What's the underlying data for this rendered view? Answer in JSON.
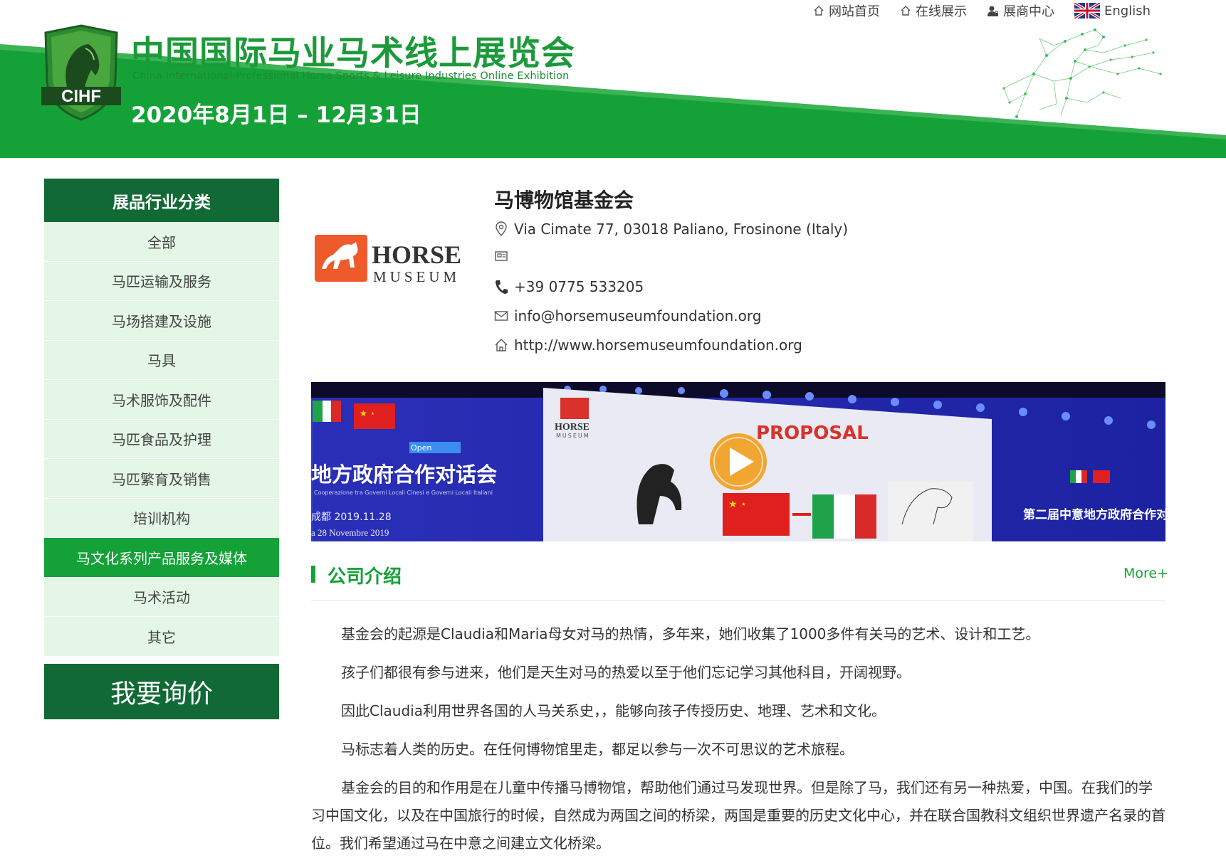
{
  "header": {
    "title": "中国国际马业马术线上展览会",
    "subtitle": "China International Professional Horse Sports & Leisure Industries Online Exhibition",
    "date": "2020年8月1日 – 12月31日",
    "logo_text": "CIHF",
    "colors": {
      "brand_green": "#14a238",
      "dark_green": "#116a35",
      "title_green": "#1c9a3a"
    }
  },
  "topnav": {
    "items": [
      {
        "label": "网站首页",
        "icon": "home-icon"
      },
      {
        "label": "在线展示",
        "icon": "home-icon"
      },
      {
        "label": "展商中心",
        "icon": "user-lock-icon"
      },
      {
        "label": "English",
        "icon": "uk-flag-icon"
      }
    ]
  },
  "sidebar": {
    "heading": "展品行业分类",
    "items": [
      {
        "label": "全部"
      },
      {
        "label": "马匹运输及服务"
      },
      {
        "label": "马场搭建及设施"
      },
      {
        "label": "马具"
      },
      {
        "label": "马术服饰及配件"
      },
      {
        "label": "马匹食品及护理"
      },
      {
        "label": "马匹繁育及销售"
      },
      {
        "label": "培训机构"
      },
      {
        "label": "马文化系列产品服务及媒体",
        "active": true
      },
      {
        "label": "马术活动"
      },
      {
        "label": "其它"
      }
    ],
    "inquiry_label": "我要询价"
  },
  "company": {
    "name": "马博物馆基金会",
    "logo_line1": "HORSE",
    "logo_line2": "MUSEUM",
    "address": "Via Cimate 77, 03018 Paliano, Frosinone (Italy)",
    "fax": "",
    "phone": "+39 0775 533205",
    "email": "info@horsemuseumfoundation.org",
    "website": "http://www.horsemuseumfoundation.org"
  },
  "video": {
    "play_icon": "play-icon",
    "banner_left_text": "地方政府合作对话会",
    "banner_left_sub": "Cooperazione tra Governi Locali Cinesi e Governi Locali Italiani",
    "banner_left_date": "成都   2019.11.28",
    "banner_left_date_it": "a   28 Novembre 2019",
    "slide_title": "PROPOSAL",
    "slide_logo1": "HORSE",
    "slide_logo2": "MUSEUM",
    "open_label": "Open",
    "banner_right_text": "第二届中意地方政府合作对话会"
  },
  "about": {
    "title": "公司介绍",
    "more_label": "More+",
    "paragraphs": [
      "基金会的起源是Claudia和Maria母女对马的热情，多年来，她们收集了1000多件有关马的艺术、设计和工艺。",
      "孩子们都很有参与进来，他们是天生对马的热爱以至于他们忘记学习其他科目，开阔视野。",
      "因此Claudia利用世界各国的人马关系史，，能够向孩子传授历史、地理、艺术和文化。",
      "马标志着人类的历史。在任何博物馆里走，都足以参与一次不可思议的艺术旅程。",
      "基金会的目的和作用是在儿童中传播马博物馆，帮助他们通过马发现世界。但是除了马，我们还有另一种热爱，中国。在我们的学习中国文化，以及在中国旅行的时候，自然成为两国之间的桥梁，两国是重要的历史文化中心，并在联合国教科文组织世界遗产名录的首位。我们希望通过马在中意之间建立文化桥梁。"
    ]
  }
}
